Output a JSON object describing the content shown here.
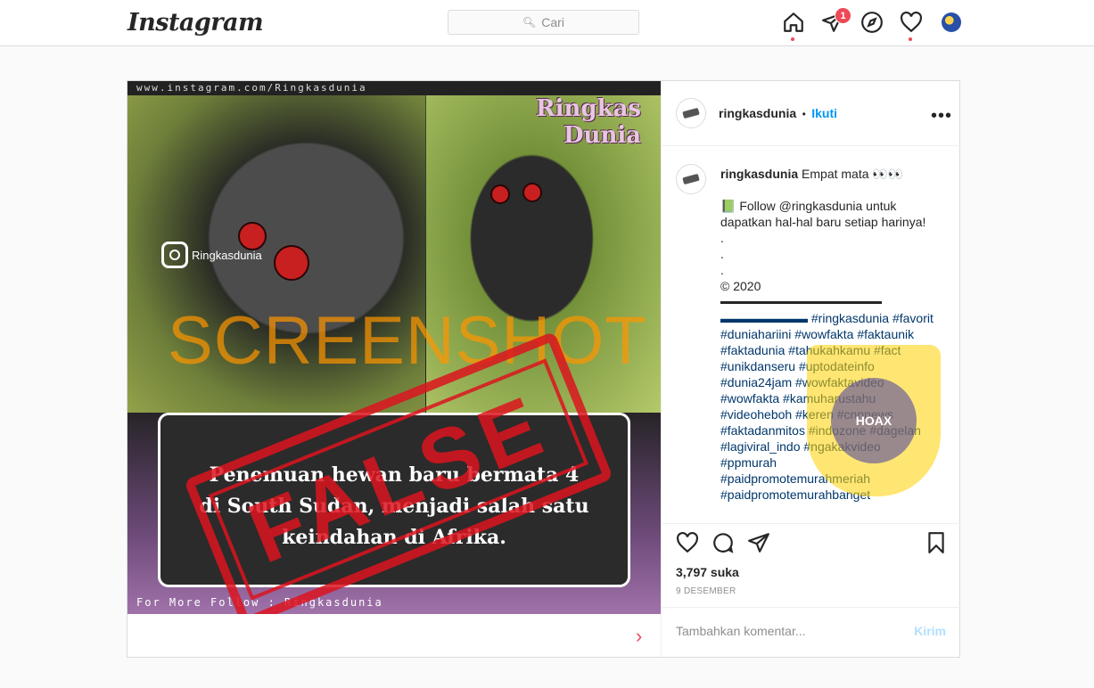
{
  "nav": {
    "logo": "Instagram",
    "search_placeholder": "Cari",
    "notification_count": "1"
  },
  "post": {
    "image": {
      "url_strip": "www.instagram.com/Ringkasdunia",
      "brand_line1": "Ringkas",
      "brand_line2": "Dunia",
      "ig_handle": "Ringkasdunia",
      "caption_line1": "Penemuan hewan baru bermata 4",
      "caption_line2": "di South Sudan, menjadi salah satu",
      "caption_line3": "keindahan di Afrika.",
      "follow_strip": "For More Follow : Ringkasdunia",
      "watermark": "SCREENSHOT BY",
      "stamp": "FALSE"
    },
    "header": {
      "username": "ringkasdunia",
      "separator": "•",
      "follow_label": "Ikuti"
    },
    "caption": {
      "username": "ringkasdunia",
      "title": "Empat mata 👀👀",
      "lines": [
        "📗 Follow @ringkasdunia untuk dapatkan hal-hal baru setiap harinya!",
        ".",
        ".",
        ".",
        "© 2020",
        "▬▬▬▬▬▬▬▬▬▬▬▬▬▬▬▬▬▬▬▬",
        "▬▬▬▬▬▬▬ #ringkasdunia #favorit",
        "#duniahariini #wowfakta #faktaunik",
        "#faktadunia #tahukahkamu #fact",
        "#unikdanseru #uptodateinfo",
        "#dunia24jam #wowfaktavideo",
        "#wowfakta #kamuharustahu",
        "#videoheboh #keren #cnnnews",
        "#faktadanmitos #indozone #dagelan",
        "#lagiviral_indo #ngakakvideo",
        "#ppmurah",
        "#paidpromotemurahmeriah",
        "#paidpromotemurahbanget"
      ]
    },
    "likes": "3,797 suka",
    "date": "9 DESEMBER",
    "comment_placeholder": "Tambahkan komentar...",
    "post_button": "Kirim",
    "seal_text": "HOAX"
  }
}
